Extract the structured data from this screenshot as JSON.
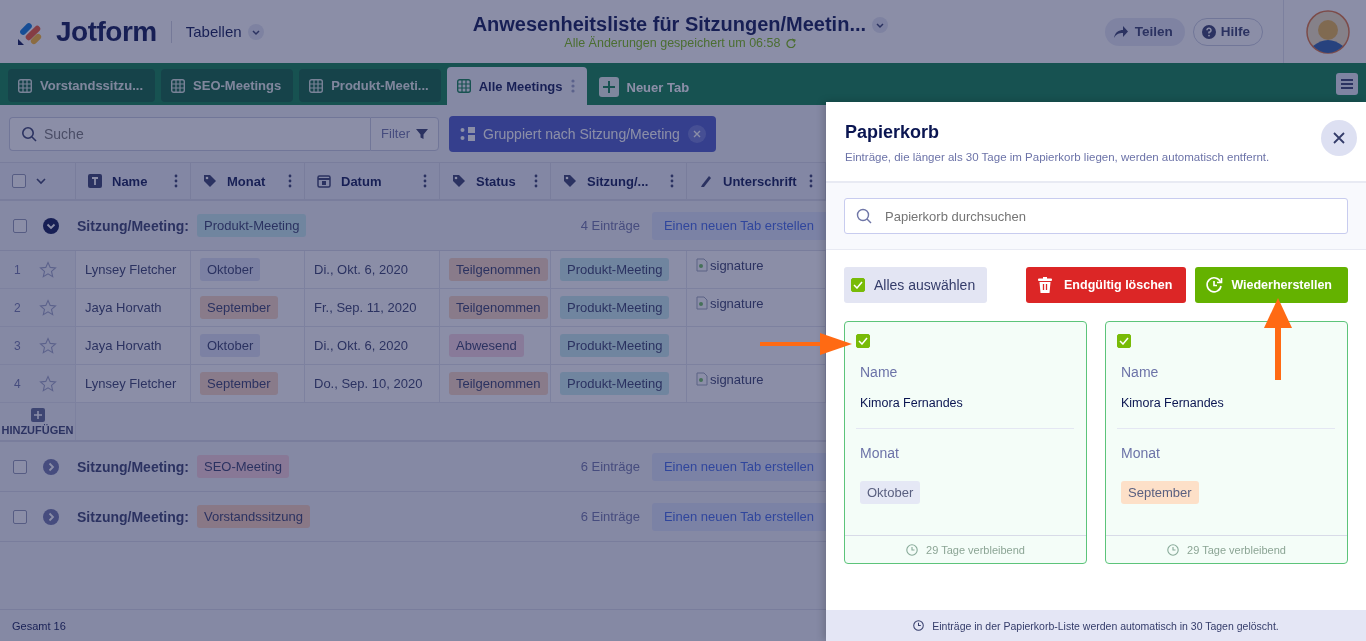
{
  "header": {
    "logo": "Jotform",
    "section": "Tabellen",
    "title": "Anwesenheitsliste für Sitzungen/Meetin...",
    "save_status": "Alle Änderungen gespeichert um 06:58",
    "share": "Teilen",
    "help": "Hilfe"
  },
  "tabs": [
    {
      "label": "Vorstandssitzu...",
      "selected": false
    },
    {
      "label": "SEO-Meetings",
      "selected": false
    },
    {
      "label": "Produkt-Meeti...",
      "selected": false
    },
    {
      "label": "Alle Meetings",
      "selected": true
    }
  ],
  "new_tab": "Neuer Tab",
  "toolbar": {
    "search": {
      "placeholder": "Suche"
    },
    "filter": "Filter",
    "grouping": "Gruppiert nach Sitzung/Meeting"
  },
  "select_all_rows": {
    "checked": false
  },
  "columns": [
    {
      "label": "Name",
      "kind": "text"
    },
    {
      "label": "Monat",
      "kind": "tag"
    },
    {
      "label": "Datum",
      "kind": "date"
    },
    {
      "label": "Status",
      "kind": "tag"
    },
    {
      "label": "Sitzung/...",
      "kind": "tag"
    },
    {
      "label": "Unterschrift",
      "kind": "signature"
    }
  ],
  "groups": [
    {
      "checked": false,
      "label": "Sitzung/Meeting:",
      "value": "Produkt-Meeting",
      "color": "#70859f",
      "count": "4 Einträge",
      "action": "Einen neuen Tab erstellen",
      "expanded": true,
      "rows": [
        {
          "number": "1",
          "starred": false,
          "name": "Lynsey Fletcher",
          "month": {
            "label": "Oktober",
            "color": "#7c81a3"
          },
          "date": "Di., Okt. 6, 2020",
          "status": {
            "label": "Teilgenommen",
            "color": "#897b8a"
          },
          "meeting": {
            "label": "Produkt-Meeting",
            "color": "#70859f"
          },
          "signature": "signature"
        },
        {
          "number": "2",
          "starred": false,
          "name": "Jaya Horvath",
          "month": {
            "label": "September",
            "color": "#897b8a"
          },
          "date": "Fr., Sep. 11, 2020",
          "status": {
            "label": "Teilgenommen",
            "color": "#897b8a"
          },
          "meeting": {
            "label": "Produkt-Meeting",
            "color": "#70859f"
          },
          "signature": "signature"
        },
        {
          "number": "3",
          "starred": false,
          "name": "Jaya Horvath",
          "month": {
            "label": "Oktober",
            "color": "#7c81a3"
          },
          "date": "Di., Okt. 6, 2020",
          "status": {
            "label": "Abwesend",
            "color": "#887a99"
          },
          "meeting": {
            "label": "Produkt-Meeting",
            "color": "#70859f"
          }
        },
        {
          "number": "4",
          "starred": false,
          "name": "Lynsey Fletcher",
          "month": {
            "label": "September",
            "color": "#897b8a"
          },
          "date": "Do., Sep. 10, 2020",
          "status": {
            "label": "Teilgenommen",
            "color": "#897b8a"
          },
          "meeting": {
            "label": "Produkt-Meeting",
            "color": "#70859f"
          },
          "signature": "signature"
        }
      ],
      "add_row": "HINZUFÜGEN"
    },
    {
      "checked": false,
      "label": "Sitzung/Meeting:",
      "value": "SEO-Meeting",
      "color": "#887896",
      "count": "6 Einträge",
      "action": "Einen neuen Tab erstellen",
      "expanded": false
    },
    {
      "checked": false,
      "label": "Sitzung/Meeting:",
      "value": "Vorstandssitzung",
      "color": "#897886",
      "count": "6 Einträge",
      "action": "Einen neuen Tab erstellen",
      "expanded": false
    }
  ],
  "footer": {
    "total": "Gesamt 16"
  },
  "trash": {
    "title": "Papierkorb",
    "subtitle": "Einträge, die länger als 30 Tage im Papierkorb liegen, werden automatisch entfernt.",
    "search": {
      "placeholder": "Papierkorb durchsuchen"
    },
    "select_all": {
      "label": "Alles auswählen",
      "checked": true
    },
    "delete": "Endgültig löschen",
    "restore": "Wiederherstellen",
    "cards": [
      {
        "checked": true,
        "name_label": "Name",
        "name": "Kimora Fernandes",
        "month_label": "Monat",
        "month": {
          "label": "Oktober",
          "color": "#e5e8f5"
        },
        "remaining": "29 Tage verbleibend"
      },
      {
        "checked": true,
        "name_label": "Name",
        "name": "Kimora Fernandes",
        "month_label": "Monat",
        "month": {
          "label": "September",
          "color": "#fde0c8"
        },
        "remaining": "29 Tage verbleibend"
      }
    ],
    "note": "Einträge in der Papierkorb-Liste werden automatisch in 30 Tagen gelöscht."
  }
}
